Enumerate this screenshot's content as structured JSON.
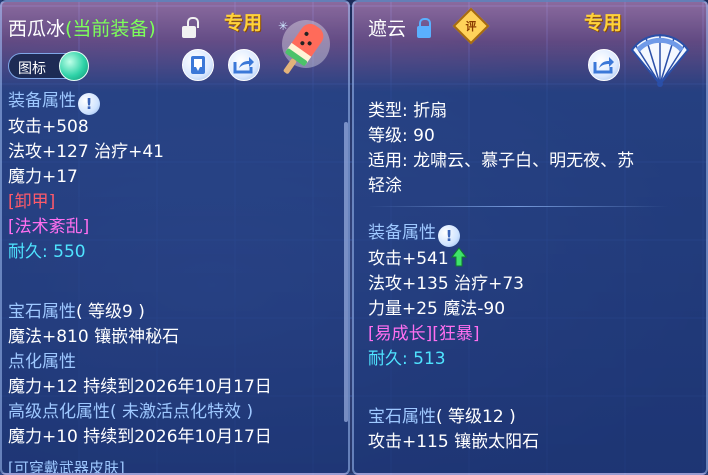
{
  "left": {
    "item_name": "西瓜冰",
    "equipped_tag": "(当前装备)",
    "exclusive_label": "专用",
    "icon_toggle_label": "图标",
    "equip_attr_heading": "装备属性",
    "help_glyph": "!",
    "attack": "攻击+508",
    "magic_heal": "法攻+127 治疗+41",
    "mana": "魔力+17",
    "tag_unarmor": "[卸甲]",
    "tag_spell_chaos": "[法术紊乱]",
    "durability": "耐久: 550",
    "gem_heading": "宝石属性",
    "gem_level": "( 等级9 )",
    "gem_effect": "魔法+810 镶嵌神秘石",
    "spot_heading": "点化属性",
    "spot_effect": "魔力+12 持续到2026年10月17日",
    "adv_spot_heading": "高级点化属性",
    "adv_spot_note": "( 未激活点化特效 )",
    "adv_spot_effect": "魔力+10 持续到2026年10月17日",
    "bottom_text": "[可穿戴武器皮肤]"
  },
  "right": {
    "item_name": "遮云",
    "rate_badge": "评",
    "exclusive_label": "专用",
    "type": "类型: 折扇",
    "level": "等级: 90",
    "usable_line1": "适用: 龙啸云、慕子白、明无夜、苏",
    "usable_line2": "轻涂",
    "equip_attr_heading": "装备属性",
    "help_glyph": "!",
    "attack": "攻击+541",
    "magic_heal": "法攻+135 治疗+73",
    "str_mana": "力量+25 魔法-90",
    "tags": "[易成长][狂暴]",
    "durability": "耐久: 513",
    "gem_heading": "宝石属性",
    "gem_level": "( 等级12 )",
    "gem_effect": "攻击+115 镶嵌太阳石"
  },
  "icons": [
    "lock-open-icon",
    "lock-closed-icon",
    "bookmark-icon",
    "share-icon",
    "popsicle-icon",
    "fan-icon",
    "help-icon",
    "upgrade-arrow-icon"
  ],
  "colors": {
    "equipped": "#7dff5a",
    "exclusive": "#ffd23a",
    "heading": "#9ec8ff",
    "durability": "#4fe4ff",
    "magenta": "#ff6ff0",
    "red": "#ff5a6a"
  }
}
